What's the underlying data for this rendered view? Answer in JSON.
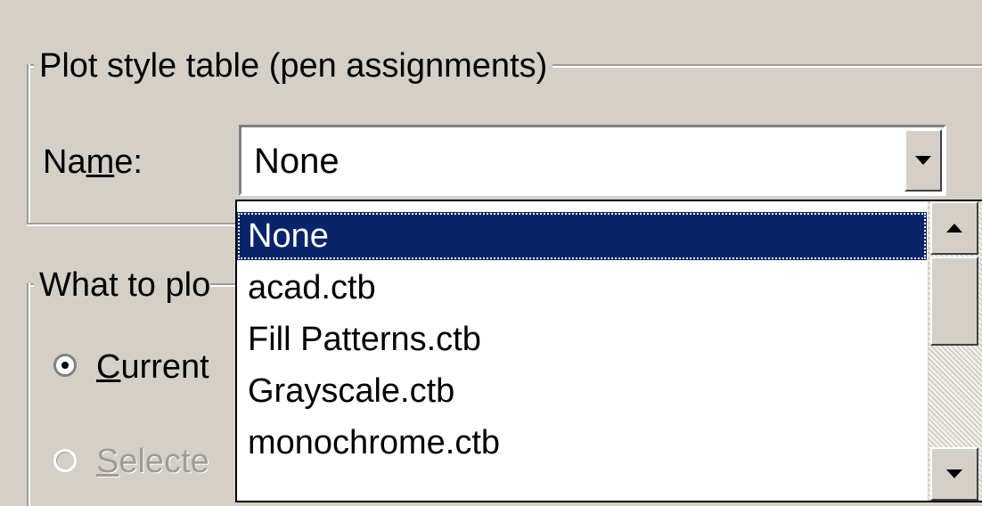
{
  "plot_style_group": {
    "title": "Plot style table (pen assignments)",
    "name_label_prefix": "Na",
    "name_label_mnemonic": "m",
    "name_label_suffix": "e:",
    "selected_value": "None"
  },
  "dropdown": {
    "options": [
      "None",
      "acad.ctb",
      "Fill Patterns.ctb",
      "Grayscale.ctb",
      "monochrome.ctb"
    ],
    "highlighted_index": 0
  },
  "what_to_plot_group": {
    "title": "What to plo",
    "radio_current_mnemonic": "C",
    "radio_current_rest": "urrent",
    "radio_current_checked": true,
    "radio_selected_mnemonic": "S",
    "radio_selected_rest": "electe",
    "radio_selected_enabled": false
  },
  "colors": {
    "dialog_bg": "#d4d0c8",
    "highlight_bg": "#0a246a",
    "highlight_text": "#ffffff",
    "disabled_text": "#a09c94"
  },
  "icons": {
    "combo_dropdown": "chevron-down-icon",
    "scroll_up": "scroll-up-arrow-icon",
    "scroll_down": "scroll-down-arrow-icon"
  }
}
